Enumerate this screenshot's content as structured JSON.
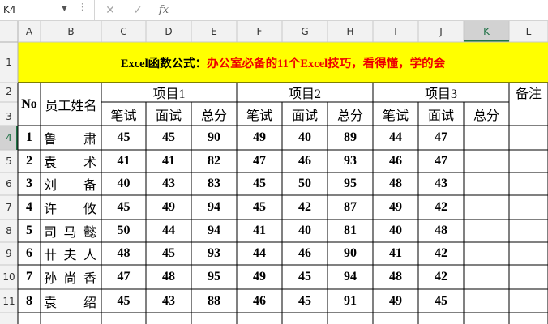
{
  "formula_bar": {
    "name_box": "K4",
    "cancel_icon": "✕",
    "enter_icon": "✓",
    "fx_label": "fx",
    "formula": ""
  },
  "columns": [
    "A",
    "B",
    "C",
    "D",
    "E",
    "F",
    "G",
    "H",
    "I",
    "J",
    "K",
    "L"
  ],
  "rows": [
    "1",
    "2",
    "3",
    "4",
    "5",
    "6",
    "7",
    "8",
    "9",
    "10",
    "11"
  ],
  "selected_cell": {
    "column": "K",
    "row": "4"
  },
  "sheet": {
    "title_prefix": "Excel函数公式：",
    "title_main": "办公室必备的11个Excel技巧，看得懂，学的会",
    "title_bg": "#ffff00",
    "title_red": "#ee0000",
    "header": {
      "no": "No",
      "name": "员工姓名",
      "remark": "备注",
      "projects": [
        "项目1",
        "项目2",
        "项目3"
      ],
      "sub": [
        "笔试",
        "面试",
        "总分"
      ]
    },
    "records": [
      {
        "no": "1",
        "name": "鲁　肃",
        "scores": [
          "45",
          "45",
          "90",
          "49",
          "40",
          "89",
          "44",
          "47",
          ""
        ]
      },
      {
        "no": "2",
        "name": "袁　术",
        "scores": [
          "41",
          "41",
          "82",
          "47",
          "46",
          "93",
          "46",
          "47",
          ""
        ]
      },
      {
        "no": "3",
        "name": "刘　备",
        "scores": [
          "40",
          "43",
          "83",
          "45",
          "50",
          "95",
          "48",
          "43",
          ""
        ]
      },
      {
        "no": "4",
        "name": "许　攸",
        "scores": [
          "45",
          "49",
          "94",
          "45",
          "42",
          "87",
          "49",
          "42",
          ""
        ]
      },
      {
        "no": "5",
        "name": "司马懿",
        "scores": [
          "50",
          "44",
          "94",
          "41",
          "40",
          "81",
          "40",
          "48",
          ""
        ]
      },
      {
        "no": "6",
        "name": "卄夫人",
        "scores": [
          "48",
          "45",
          "93",
          "44",
          "46",
          "90",
          "41",
          "42",
          ""
        ]
      },
      {
        "no": "7",
        "name": "孙尚香",
        "scores": [
          "47",
          "48",
          "95",
          "49",
          "45",
          "94",
          "48",
          "42",
          ""
        ]
      },
      {
        "no": "8",
        "name": "袁　绍",
        "scores": [
          "45",
          "43",
          "88",
          "46",
          "45",
          "91",
          "49",
          "45",
          ""
        ]
      }
    ]
  }
}
